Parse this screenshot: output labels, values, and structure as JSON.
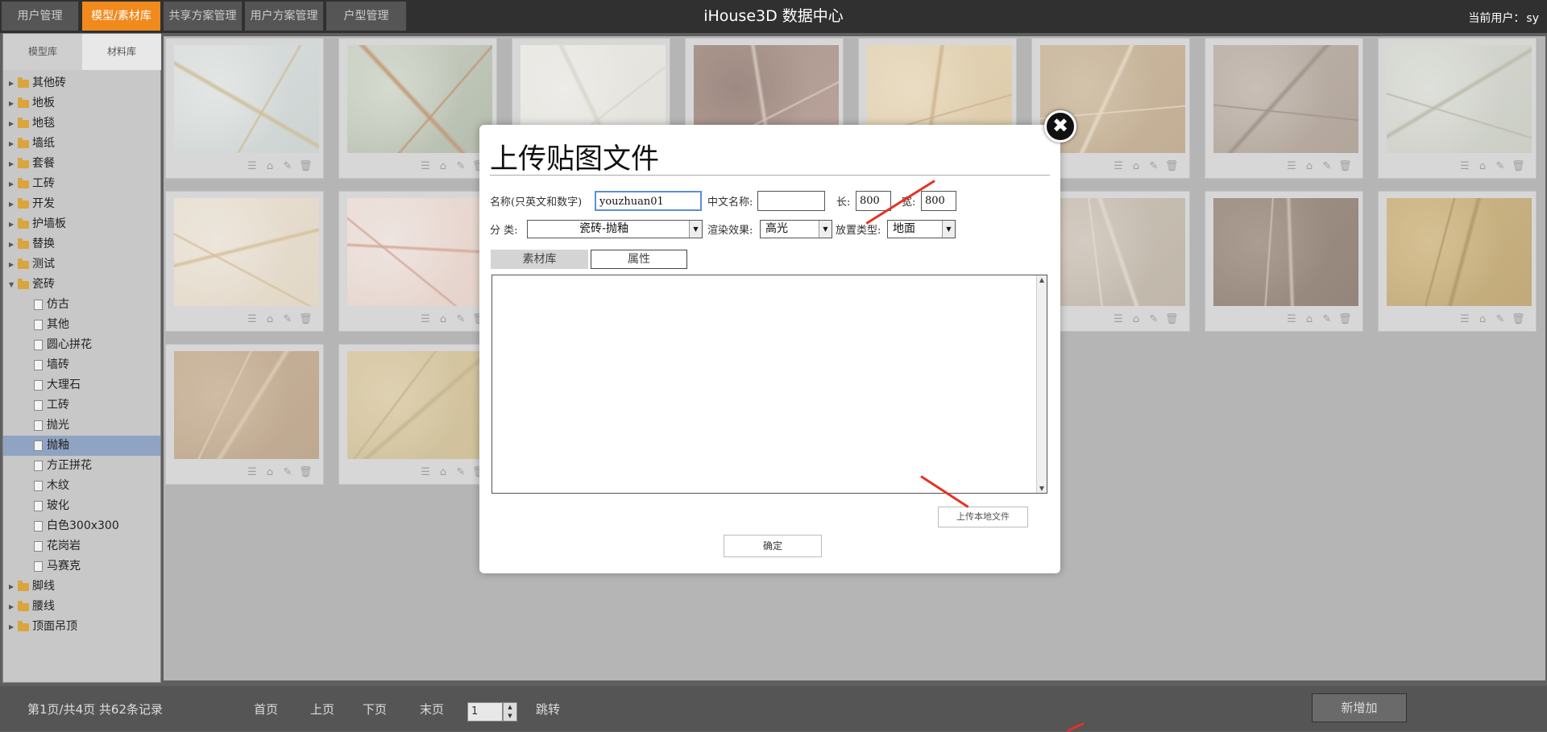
{
  "nav": {
    "tabs": [
      "用户管理",
      "模型/素材库",
      "共享方案管理",
      "用户方案管理",
      "户型管理"
    ],
    "active_index": 1,
    "app_title": "iHouse3D 数据中心",
    "current_user_label": "当前用户：",
    "current_user": "sy"
  },
  "sidebar": {
    "tabs": [
      "模型库",
      "材料库"
    ],
    "active_tab": 1,
    "tree_before": [
      "其他砖",
      "地板",
      "地毯",
      "墙纸",
      "套餐",
      "工砖",
      "开发",
      "护墙板",
      "替换",
      "测试"
    ],
    "expanded_folder": "瓷砖",
    "children": [
      "仿古",
      "其他",
      "圆心拼花",
      "墙砖",
      "大理石",
      "工砖",
      "抛光",
      "抛釉",
      "方正拼花",
      "木纹",
      "玻化",
      "白色300x300",
      "花岗岩",
      "马赛克"
    ],
    "selected_child": "抛釉",
    "tree_after": [
      "脚线",
      "腰线",
      "顶面吊顶"
    ]
  },
  "grid": {
    "tiles": [
      {
        "colors": [
          "#dde4e3",
          "#c9d2d0",
          "#e8ece9"
        ],
        "veins": "#cdb88a"
      },
      {
        "colors": [
          "#c8d0c0",
          "#a9b49f",
          "#d6dccd"
        ],
        "veins": "#b9875a"
      },
      {
        "colors": [
          "#f0efe8",
          "#e7e5dc",
          "#f4f3ee"
        ],
        "veins": "#dad7cc"
      },
      {
        "colors": [
          "#9c8276",
          "#b09287",
          "#8a7065"
        ],
        "veins": "#d5c1b4"
      },
      {
        "colors": [
          "#ead6ae",
          "#dfc79c",
          "#f1dfbd"
        ],
        "veins": "#cfa97a"
      },
      {
        "colors": [
          "#c8b08f",
          "#bba17f",
          "#d3bd9e"
        ],
        "veins": "#ead9bf"
      },
      {
        "colors": [
          "#b5a79c",
          "#a69688",
          "#c4b7ab"
        ],
        "veins": "#8e7e72"
      },
      {
        "colors": [
          "#d6d9d0",
          "#c9ccc1",
          "#e1e3dc"
        ],
        "veins": "#b4b39f"
      },
      {
        "colors": [
          "#efe4d2",
          "#e6d8c2",
          "#f4ebde"
        ],
        "veins": "#d7b98a"
      },
      {
        "colors": [
          "#f2dfd6",
          "#ead2c7",
          "#f6e9e3"
        ],
        "veins": "#d49a86"
      },
      null,
      null,
      null,
      {
        "colors": [
          "#c8bcad",
          "#b9ac9c",
          "#d3c8bb"
        ],
        "veins": "#e3d9cc"
      },
      {
        "colors": [
          "#8f7a6c",
          "#7f6b5e",
          "#9e8a7b"
        ],
        "veins": "#c9b8aa"
      },
      {
        "colors": [
          "#c9ab6c",
          "#bb9b5c",
          "#d6ba7e"
        ],
        "veins": "#a5854c"
      },
      {
        "colors": [
          "#c4a787",
          "#b69979",
          "#cdb394"
        ],
        "veins": "#dcc6ab"
      },
      {
        "colors": [
          "#d9c596",
          "#cdb887",
          "#e1d0a6"
        ],
        "veins": "#c2ab7a"
      }
    ]
  },
  "modal": {
    "title": "上传贴图文件",
    "name_label": "名称(只英文和数字)",
    "name_value": "youzhuan01",
    "cn_name_label": "中文名称:",
    "cn_name_value": "",
    "length_label": "长:",
    "length_value": "800",
    "width_label": "宽:",
    "width_value": "800",
    "category_label": "分 类:",
    "category_value": "瓷砖-抛釉",
    "render_label": "渲染效果:",
    "render_value": "高光",
    "place_label": "放置类型:",
    "place_value": "地面",
    "tab_library": "素材库",
    "tab_attributes": "属性",
    "upload_button": "上传本地文件",
    "confirm_button": "确定",
    "close_icon": "close-icon"
  },
  "pagination": {
    "summary": "第1页/共4页  共62条记录",
    "first": "首页",
    "prev": "上页",
    "next": "下页",
    "last": "末页",
    "page_value": "1",
    "jump": "跳转",
    "add_new": "新增加"
  },
  "colors": {
    "accent": "#f08a1c",
    "selected_row": "#8fa3c2",
    "annotation_arrow": "#e53222"
  }
}
